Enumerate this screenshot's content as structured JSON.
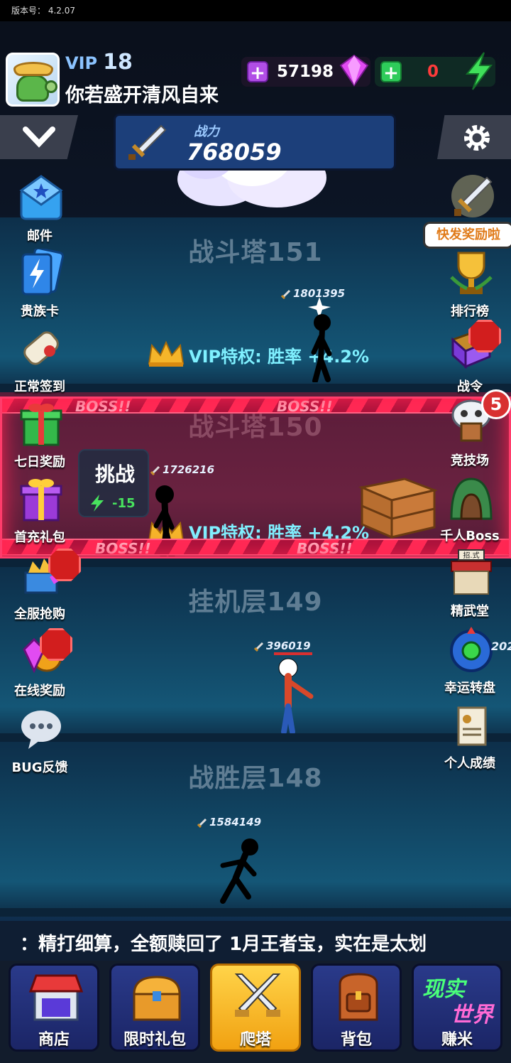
{
  "status_bar": {
    "version_label": "版本号：",
    "version": "4.2.07"
  },
  "player": {
    "vip_label": "VIP",
    "vip_level": "18",
    "nickname": "你若盛开清风自来"
  },
  "currency": {
    "gems": "57198",
    "energy": "0",
    "plus_symbol": "+"
  },
  "power": {
    "label": "战力",
    "value": "768059"
  },
  "tip_bubble": "快发奖励啦",
  "arena_badge": "5",
  "floors": [
    {
      "title": "战斗塔151",
      "perk": "VIP特权: 胜率 +4.2%",
      "enemy_power": "1801395"
    },
    {
      "title": "战斗塔150",
      "perk": "VIP特权: 胜率 +4.2%",
      "enemy_power": "1726216",
      "boss_label": "BOSS!!"
    },
    {
      "title": "挂机层149",
      "player_power": "396019"
    },
    {
      "title": "战胜层148",
      "enemy_power": "1584149"
    }
  ],
  "challenge": {
    "label": "挑战",
    "cost": "-15"
  },
  "extra_number": "202",
  "left_menu": [
    {
      "label": "邮件",
      "icon": "mail-icon"
    },
    {
      "label": "贵族卡",
      "icon": "noble-card-icon"
    },
    {
      "label": "正常签到",
      "icon": "sign-in-scroll-icon"
    },
    {
      "label": "七日奖励",
      "icon": "gift-box-green-icon"
    },
    {
      "label": "首充礼包",
      "icon": "gift-box-purple-icon"
    },
    {
      "label": "全服抢购",
      "icon": "treasure-pile-icon"
    },
    {
      "label": "在线奖励",
      "icon": "gem-clock-icon"
    },
    {
      "label": "BUG反馈",
      "icon": "chat-bubble-icon"
    }
  ],
  "right_menu": [
    {
      "label": "",
      "icon": "shining-sword-icon"
    },
    {
      "label": "排行榜",
      "icon": "trophy-icon"
    },
    {
      "label": "战令",
      "icon": "battle-pass-book-icon"
    },
    {
      "label": "竞技场",
      "icon": "skull-arena-icon"
    },
    {
      "label": "千人Boss",
      "icon": "boss-cave-icon"
    },
    {
      "label": "精武堂",
      "icon": "martial-hall-icon"
    },
    {
      "label": "幸运转盘",
      "icon": "lucky-wheel-icon"
    },
    {
      "label": "个人成绩",
      "icon": "report-scroll-icon"
    }
  ],
  "martial_hall_sign": "招.式",
  "marquee": "：精打细算，全额赎回了 1月王者宝，实在是太划",
  "bottom_nav": [
    {
      "label": "商店",
      "icon": "shop-icon",
      "active": false
    },
    {
      "label": "限时礼包",
      "icon": "treasure-chest-icon",
      "active": false
    },
    {
      "label": "爬塔",
      "icon": "crossed-swords-icon",
      "active": true
    },
    {
      "label": "背包",
      "icon": "backpack-icon",
      "active": false
    },
    {
      "label": "赚米",
      "icon": "real-world-icon",
      "active": false,
      "logo_top": "现实",
      "logo_bottom": "世界"
    }
  ],
  "colors": {
    "boss": "#ff3c6b",
    "perk": "#7ff0ff",
    "active_tab": "#ffc62a"
  }
}
